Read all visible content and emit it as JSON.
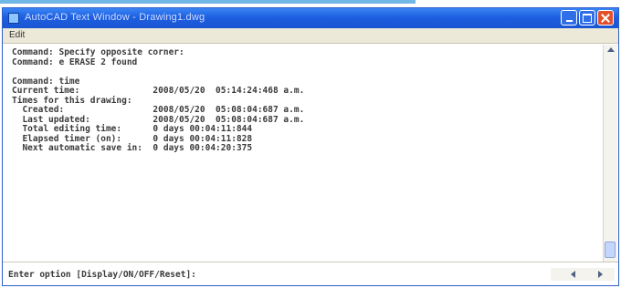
{
  "window": {
    "title": "AutoCAD Text Window - Drawing1.dwg",
    "icons": {
      "app": "autocad-icon",
      "minimize": "minimize-icon",
      "maximize": "maximize-icon",
      "close": "close-icon"
    }
  },
  "menu": {
    "edit": "Edit"
  },
  "history": [
    "Command: Specify opposite corner:",
    "Command: e ERASE 2 found",
    "",
    "Command: time",
    "Current time:              2008/05/20  05:14:24:468 a.m.",
    "Times for this drawing:",
    "  Created:                 2008/05/20  05:08:04:687 a.m.",
    "  Last updated:            2008/05/20  05:08:04:687 a.m.",
    "  Total editing time:      0 days 00:04:11:844",
    "  Elapsed timer (on):      0 days 00:04:11:828",
    "  Next automatic save in:  0 days 00:04:20:375"
  ],
  "command_line": "Enter option [Display/ON/OFF/Reset]:",
  "colors": {
    "titlebar": "#1d5fe0",
    "close_button": "#e2512c",
    "accent_rule": "#6fb7e6"
  }
}
